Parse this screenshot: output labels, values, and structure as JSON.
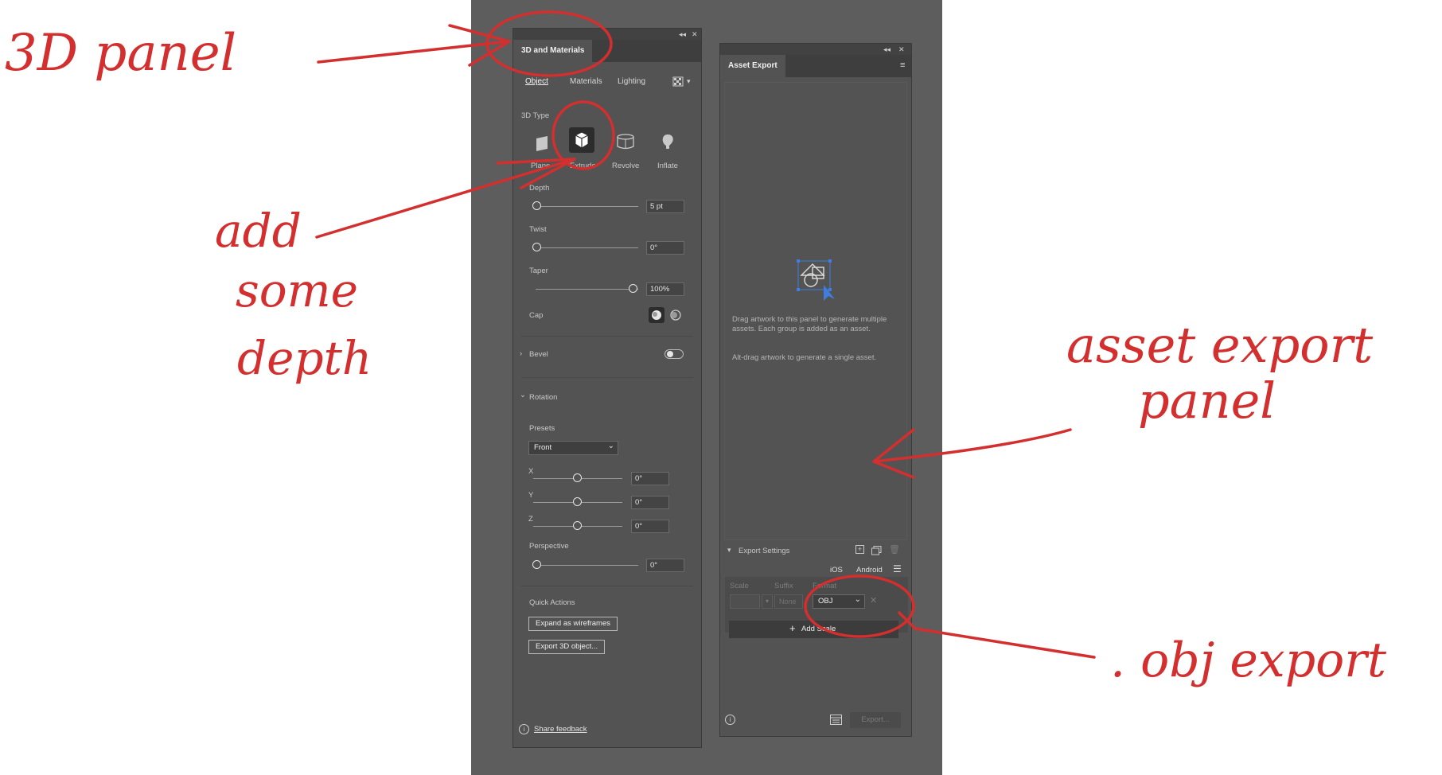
{
  "annotations": {
    "panel_3d": "3D panel",
    "depth": [
      "add",
      "some",
      "depth"
    ],
    "asset_export": [
      "asset export",
      "panel"
    ],
    "obj_export": ". obj export"
  },
  "materials_panel": {
    "tab_title": "3D and Materials",
    "collapse_icon": "double-chevron-left-icon",
    "close_icon": "close-icon",
    "subtabs": [
      "Object",
      "Materials",
      "Lighting"
    ],
    "active_subtab": "Object",
    "type_label": "3D Type",
    "types": [
      {
        "label": "Plane",
        "icon": "plane-icon"
      },
      {
        "label": "Extrude",
        "icon": "extrude-icon",
        "selected": true
      },
      {
        "label": "Revolve",
        "icon": "revolve-icon"
      },
      {
        "label": "Inflate",
        "icon": "inflate-icon"
      }
    ],
    "depth": {
      "label": "Depth",
      "value": "5 pt",
      "level": 0.0
    },
    "twist": {
      "label": "Twist",
      "value": "0°",
      "level": 0.0
    },
    "taper": {
      "label": "Taper",
      "value": "100%",
      "level": 1.0
    },
    "cap_label": "Cap",
    "bevel": {
      "label": "Bevel",
      "enabled": false
    },
    "rotation": {
      "label": "Rotation",
      "presets_label": "Presets",
      "preset_value": "Front",
      "axes": [
        {
          "label": "X",
          "value": "0°",
          "level": 0.5
        },
        {
          "label": "Y",
          "value": "0°",
          "level": 0.5
        },
        {
          "label": "Z",
          "value": "0°",
          "level": 0.5
        }
      ],
      "perspective": {
        "label": "Perspective",
        "value": "0°",
        "level": 0.0
      }
    },
    "quick_actions": {
      "label": "Quick Actions",
      "expand": "Expand as wireframes",
      "export": "Export 3D object..."
    },
    "feedback": "Share feedback"
  },
  "asset_panel": {
    "tab_title": "Asset Export",
    "menu_icon": "hamburger-menu-icon",
    "drag_text": "Drag artwork to this panel to generate multiple assets. Each group is added as an asset.",
    "alt_text": "Alt-drag artwork to generate a single asset.",
    "export_settings_label": "Export Settings",
    "platforms": [
      "iOS",
      "Android"
    ],
    "columns": {
      "scale": "Scale",
      "suffix": "Suffix",
      "format": "Format"
    },
    "suffix_placeholder": "None",
    "format_value": "OBJ",
    "add_scale": "Add Scale",
    "export_button": "Export..."
  }
}
